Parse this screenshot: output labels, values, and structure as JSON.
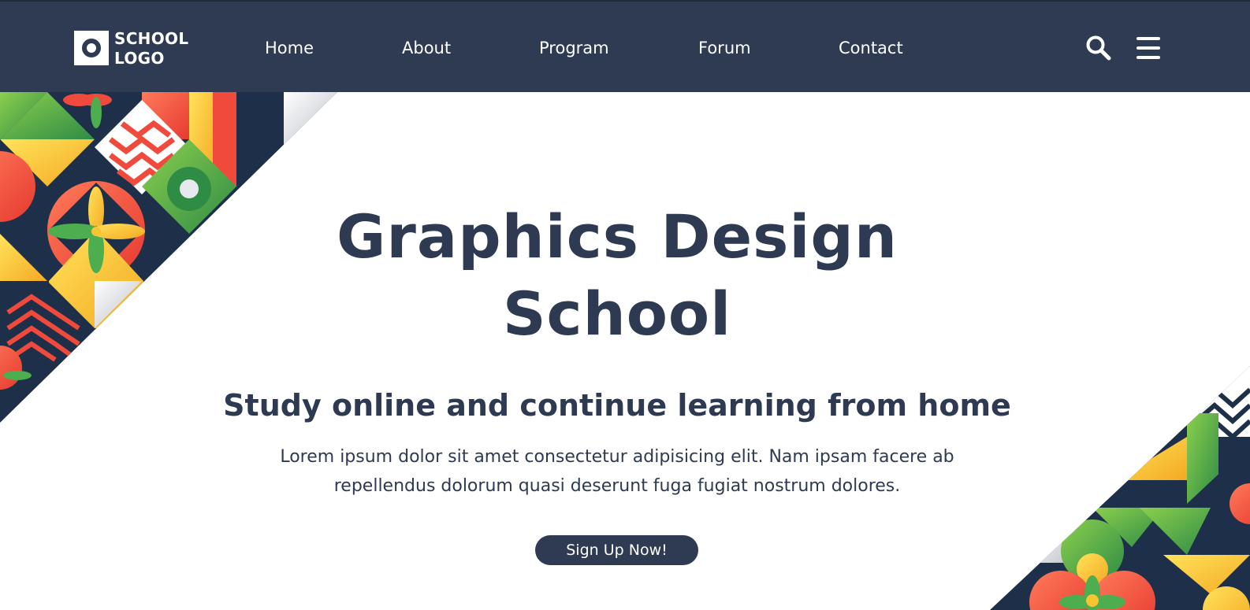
{
  "logo": {
    "text": "SCHOOL\nLOGO"
  },
  "nav": {
    "items": [
      {
        "label": "Home"
      },
      {
        "label": "About"
      },
      {
        "label": "Program"
      },
      {
        "label": "Forum"
      },
      {
        "label": "Contact"
      }
    ]
  },
  "header_icons": {
    "search": "search-icon",
    "menu": "hamburger-menu-icon"
  },
  "hero": {
    "title": "Graphics Design School",
    "subtitle": "Study online and continue learning from home",
    "body": "Lorem ipsum dolor sit amet consectetur adipisicing elit. Nam ipsam facere ab repellendus dolorum quasi deserunt fuga fugiat nostrum dolores.",
    "cta_label": "Sign Up Now!"
  },
  "colors": {
    "navbar": "#2e3b53",
    "text": "#2d3a52",
    "accent_red": "#ef4a3c",
    "accent_green": "#4cae4f",
    "accent_yellow": "#f6c531",
    "navy": "#1e2f49"
  }
}
